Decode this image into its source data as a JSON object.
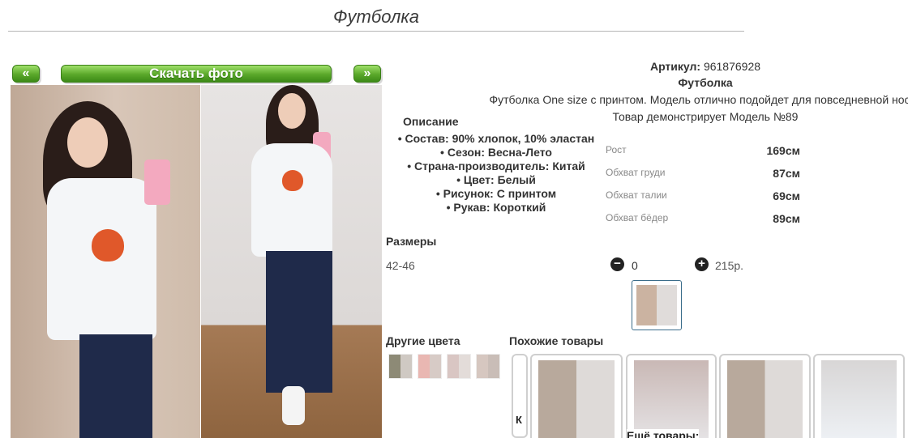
{
  "title": "Футболка",
  "gallery": {
    "prev_label": "«",
    "download_label": "Скачать фото",
    "next_label": "»"
  },
  "product": {
    "article_label": "Артикул:",
    "article_value": "961876928",
    "name": "Футболка",
    "description": "Футболка One size с принтом. Модель отлично подойдет для повседневной носки",
    "model_note": "Товар демонстрирует Модель №89"
  },
  "description_block": {
    "title": "Описание",
    "items": [
      "Состав: 90% хлопок, 10% эластан",
      "Сезон: Весна-Лето",
      "Страна-производитель: Китай",
      "Цвет: Белый",
      "Рисунок: С принтом",
      "Рукав: Короткий"
    ]
  },
  "measurements": [
    {
      "label": "Рост",
      "value": "169см"
    },
    {
      "label": "Обхват груди",
      "value": "87см"
    },
    {
      "label": "Обхват талии",
      "value": "69см"
    },
    {
      "label": "Обхват бёдер",
      "value": "89см"
    }
  ],
  "sizes": {
    "title": "Размеры",
    "size_name": "42-46",
    "minus_label": "−",
    "quantity": "0",
    "plus_label": "+",
    "price": "215р."
  },
  "other_colors": {
    "title": "Другие цвета",
    "thumbs": [
      "#8d8a76",
      "#e9b7b2",
      "#d9c6c3",
      "#d6c7c0",
      "#b9c9d8"
    ]
  },
  "similar": {
    "title": "Похожие товары",
    "scroll_icon": "К",
    "more_label": "Ещё товары:"
  },
  "colors": {
    "accent_green": "#5aa82a",
    "shirt_white": "#f4f6f8",
    "jeans_navy": "#1f2a4a"
  }
}
